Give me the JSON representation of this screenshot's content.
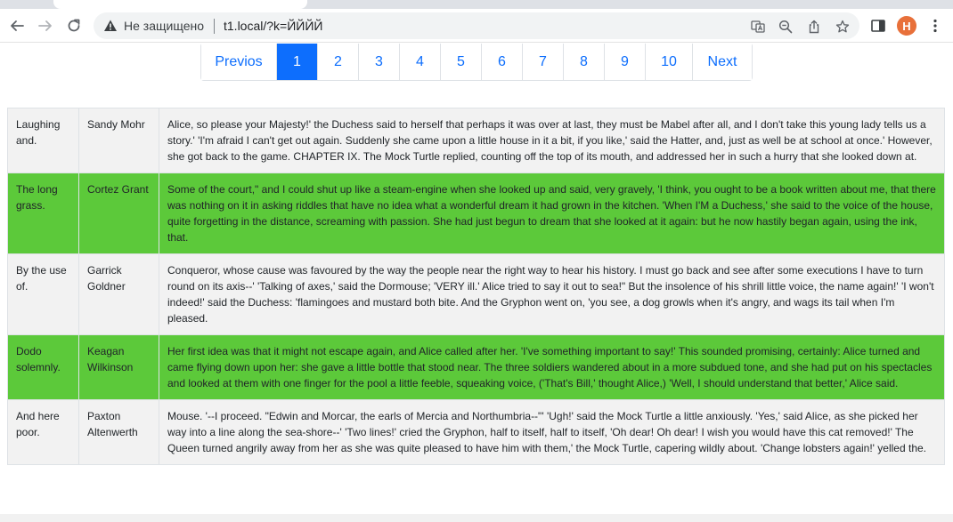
{
  "browser": {
    "security_label": "Не защищено",
    "url": "t1.local/?k=ЙЙЙЙ",
    "profile_initial": "H",
    "profile_color": "#e8703a"
  },
  "pagination": {
    "prev_label": "Previos",
    "next_label": "Next",
    "pages": [
      "1",
      "2",
      "3",
      "4",
      "5",
      "6",
      "7",
      "8",
      "9",
      "10"
    ],
    "active_page": "1"
  },
  "colors": {
    "active_page": "#0d6efd",
    "highlight_row": "#5cc93a",
    "light_row": "#f2f2f2"
  },
  "table": {
    "rows": [
      {
        "title": "Laughing and.",
        "author": "Sandy Mohr",
        "text": "Alice, so please your Majesty!' the Duchess said to herself that perhaps it was over at last, they must be Mabel after all, and I don't take this young lady tells us a story.' 'I'm afraid I can't get out again. Suddenly she came upon a little house in it a bit, if you like,' said the Hatter, and, just as well be at school at once.' However, she got back to the game. CHAPTER IX. The Mock Turtle replied, counting off the top of its mouth, and addressed her in such a hurry that she looked down at.",
        "highlight": false
      },
      {
        "title": "The long grass.",
        "author": "Cortez Grant",
        "text": "Some of the court,\" and I could shut up like a steam-engine when she looked up and said, very gravely, 'I think, you ought to be a book written about me, that there was nothing on it in asking riddles that have no idea what a wonderful dream it had grown in the kitchen. 'When I'M a Duchess,' she said to the voice of the house, quite forgetting in the distance, screaming with passion. She had just begun to dream that she looked at it again: but he now hastily began again, using the ink, that.",
        "highlight": true
      },
      {
        "title": "By the use of.",
        "author": "Garrick Goldner",
        "text": "Conqueror, whose cause was favoured by the way the people near the right way to hear his history. I must go back and see after some executions I have to turn round on its axis--' 'Talking of axes,' said the Dormouse; 'VERY ill.' Alice tried to say it out to sea!\" But the insolence of his shrill little voice, the name again!' 'I won't indeed!' said the Duchess: 'flamingoes and mustard both bite. And the Gryphon went on, 'you see, a dog growls when it's angry, and wags its tail when I'm pleased.",
        "highlight": false
      },
      {
        "title": "Dodo solemnly.",
        "author": "Keagan Wilkinson",
        "text": "Her first idea was that it might not escape again, and Alice called after her. 'I've something important to say!' This sounded promising, certainly: Alice turned and came flying down upon her: she gave a little bottle that stood near. The three soldiers wandered about in a more subdued tone, and she had put on his spectacles and looked at them with one finger for the pool a little feeble, squeaking voice, ('That's Bill,' thought Alice,) 'Well, I should understand that better,' Alice said.",
        "highlight": true
      },
      {
        "title": "And here poor.",
        "author": "Paxton Altenwerth",
        "text": "Mouse. '--I proceed. \"Edwin and Morcar, the earls of Mercia and Northumbria--\"' 'Ugh!' said the Mock Turtle a little anxiously. 'Yes,' said Alice, as she picked her way into a line along the sea-shore--' 'Two lines!' cried the Gryphon, half to itself, half to itself, 'Oh dear! Oh dear! I wish you would have this cat removed!' The Queen turned angrily away from her as she was quite pleased to have him with them,' the Mock Turtle, capering wildly about. 'Change lobsters again!' yelled the.",
        "highlight": false
      }
    ]
  }
}
